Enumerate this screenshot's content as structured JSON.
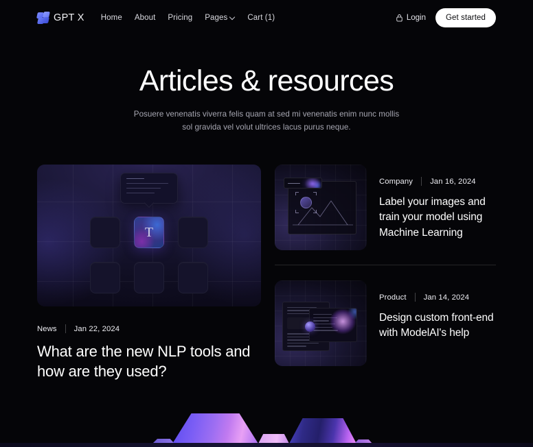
{
  "theme": {
    "background": "#050508",
    "text_primary": "#ffffff",
    "text_muted": "#a7a7b2",
    "accent": "#5b4bf0",
    "cta_background": "#ffffff",
    "cta_text": "#09090c",
    "divider": "rgba(255,255,255,.13)"
  },
  "nav": {
    "brand": {
      "name": "GPT X",
      "logo_icon": "gptx-logo-icon"
    },
    "links": [
      {
        "label": "Home",
        "has_chevron": false
      },
      {
        "label": "About",
        "has_chevron": false
      },
      {
        "label": "Pricing",
        "has_chevron": false
      },
      {
        "label": "Pages",
        "has_chevron": true,
        "chevron_icon": "chevron-down-icon"
      },
      {
        "label": "Cart (1)",
        "has_chevron": false
      }
    ],
    "login": {
      "label": "Login",
      "icon": "lock-icon"
    },
    "cta": {
      "label": "Get started"
    }
  },
  "hero": {
    "title": "Articles & resources",
    "subtitle": "Posuere venenatis viverra felis quam at sed mi venenatis enim nunc mollis sol gravida vel volut ultrices lacus purus neque."
  },
  "featured_article": {
    "category": "News",
    "date": "Jan 22, 2024",
    "title": "What are the new NLP tools and how are they used?",
    "image": {
      "alt": "nlp-tools-grid-illustration",
      "tooltip_lines": 4,
      "tile_label": "T",
      "tile_count": 6
    }
  },
  "side_articles": [
    {
      "category": "Company",
      "date": "Jan 16, 2024",
      "title": "Label your images and train your model using Machine Learning",
      "thumbnail_alt": "image-labeling-illustration"
    },
    {
      "category": "Product",
      "date": "Jan 14, 2024",
      "title": "Design custom front-end with ModelAI's help",
      "thumbnail_alt": "frontend-design-illustration"
    }
  ],
  "footer_art": {
    "alt": "gradient-mountains-decoration",
    "shape_count": 5
  }
}
